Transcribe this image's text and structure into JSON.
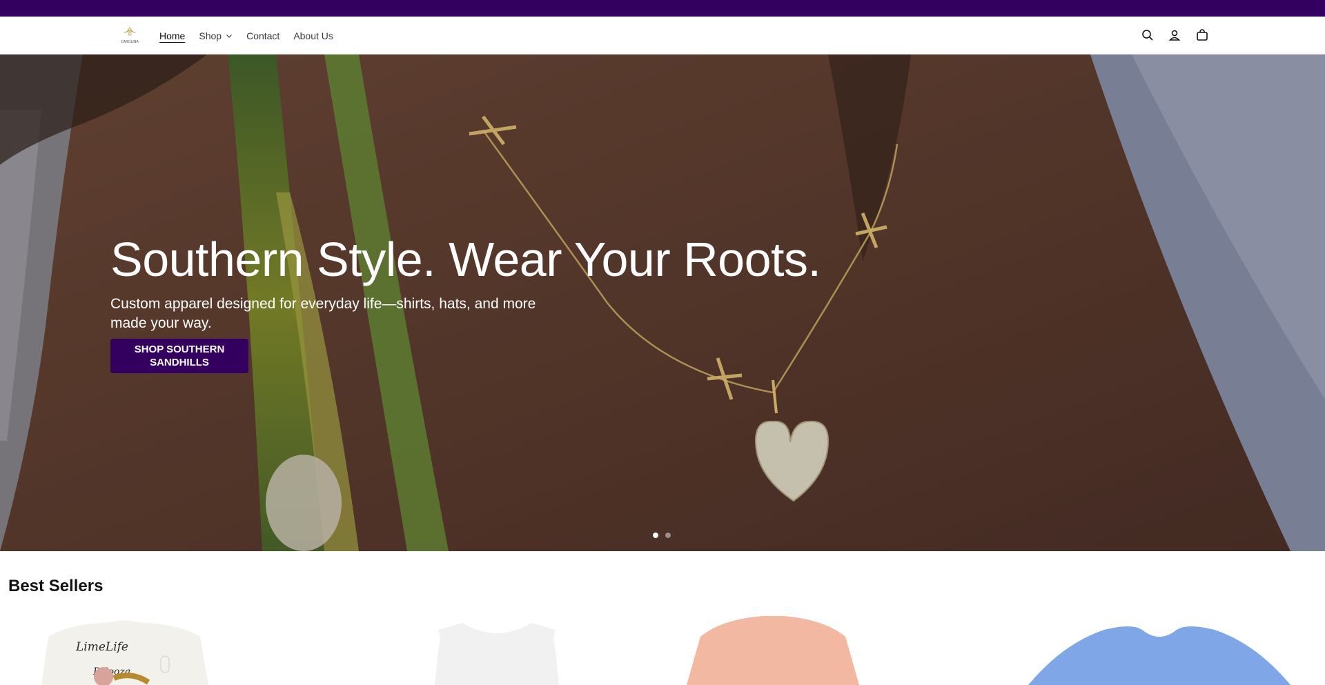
{
  "colors": {
    "brand": "#33005f",
    "text": "#121212",
    "white": "#ffffff"
  },
  "nav": {
    "logo_text": "CAROLINA",
    "links": [
      {
        "label": "Home",
        "active": true
      },
      {
        "label": "Shop",
        "has_dropdown": true
      },
      {
        "label": "Contact"
      },
      {
        "label": "About Us"
      }
    ],
    "icons": [
      "search-icon",
      "account-icon",
      "cart-icon"
    ]
  },
  "hero": {
    "title": "Southern Style. Wear Your Roots.",
    "subtitle": "Custom apparel designed for everyday life—shirts, hats, and more made your way.",
    "cta_label": "SHOP SOUTHERN SANDHILLS",
    "slides_count": 2,
    "active_slide": 1
  },
  "best_sellers": {
    "title": "Best Sellers",
    "product_prints": [
      "LimeLife",
      "Palooza"
    ]
  }
}
